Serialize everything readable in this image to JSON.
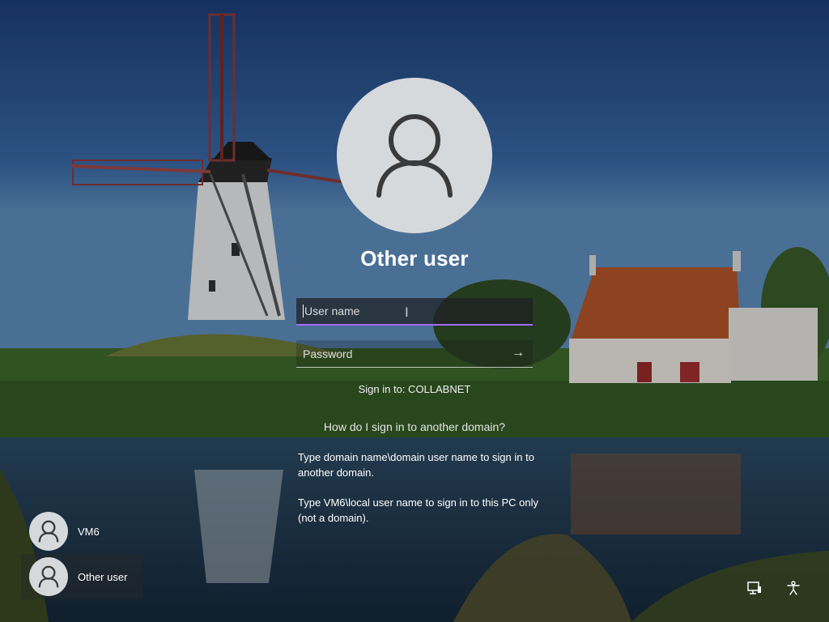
{
  "login": {
    "title": "Other user",
    "username_placeholder": "User name",
    "password_placeholder": "Password",
    "sign_in_to": "Sign in to: COLLABNET",
    "help_link": "How do I sign in to another domain?",
    "help_text_1": "Type domain name\\domain user name to sign in to another domain.",
    "help_text_2": "Type VM6\\local user name to sign in to this PC only (not a domain)."
  },
  "users": [
    {
      "name": "VM6"
    },
    {
      "name": "Other user"
    }
  ],
  "tray": {
    "network_icon": "network-icon",
    "accessibility_icon": "accessibility-icon"
  },
  "colors": {
    "focus_underline": "#a26cff",
    "avatar_bg": "#d6d9dc"
  }
}
